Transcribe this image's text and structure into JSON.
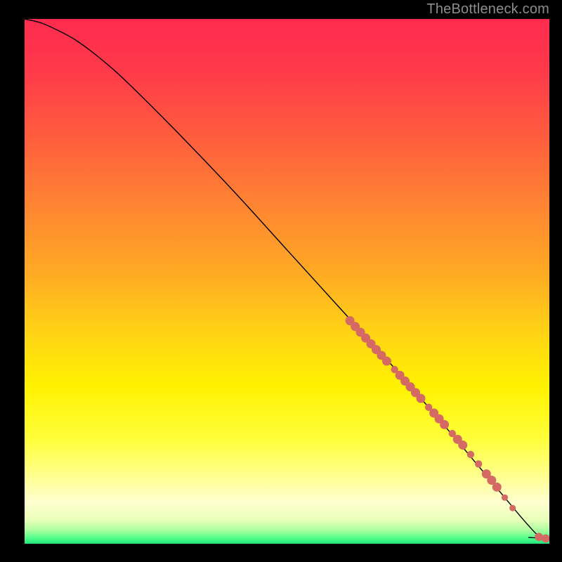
{
  "attribution": "TheBottleneck.com",
  "colors": {
    "background": "#000000",
    "curve": "#000000",
    "scatter": "#d46a63",
    "attribution_text": "#8d8d8d"
  },
  "gradient_stops": [
    {
      "offset": 0.0,
      "color": "#ff2b4f"
    },
    {
      "offset": 0.1,
      "color": "#ff3a4a"
    },
    {
      "offset": 0.22,
      "color": "#ff5c3e"
    },
    {
      "offset": 0.35,
      "color": "#ff8332"
    },
    {
      "offset": 0.48,
      "color": "#ffa924"
    },
    {
      "offset": 0.6,
      "color": "#ffd414"
    },
    {
      "offset": 0.7,
      "color": "#fff200"
    },
    {
      "offset": 0.8,
      "color": "#ffff3a"
    },
    {
      "offset": 0.87,
      "color": "#ffff8e"
    },
    {
      "offset": 0.92,
      "color": "#ffffd0"
    },
    {
      "offset": 0.955,
      "color": "#e8ffb8"
    },
    {
      "offset": 0.975,
      "color": "#a8ff9e"
    },
    {
      "offset": 0.99,
      "color": "#4cff8a"
    },
    {
      "offset": 1.0,
      "color": "#22e37a"
    }
  ],
  "chart_data": {
    "type": "line",
    "title": "",
    "xlabel": "",
    "ylabel": "",
    "xlim": [
      0,
      100
    ],
    "ylim": [
      0,
      100
    ],
    "series": [
      {
        "name": "curve",
        "x": [
          0,
          3,
          6,
          10,
          15,
          20,
          30,
          40,
          50,
          60,
          70,
          80,
          88,
          93,
          96,
          98,
          100
        ],
        "y": [
          100,
          99.3,
          98.0,
          95.8,
          92.0,
          87.5,
          77.5,
          67.0,
          56.0,
          45.0,
          34.0,
          22.5,
          13.0,
          7.0,
          3.5,
          1.5,
          1.0
        ]
      }
    ],
    "scatter": {
      "name": "highlight-points",
      "points": [
        {
          "x": 62,
          "y": 42.5,
          "r": 1.0
        },
        {
          "x": 63,
          "y": 41.4,
          "r": 1.0
        },
        {
          "x": 64,
          "y": 40.3,
          "r": 1.0
        },
        {
          "x": 65,
          "y": 39.2,
          "r": 1.0
        },
        {
          "x": 66,
          "y": 38.1,
          "r": 1.0
        },
        {
          "x": 67,
          "y": 37.0,
          "r": 1.0
        },
        {
          "x": 68,
          "y": 35.9,
          "r": 1.0
        },
        {
          "x": 69,
          "y": 34.8,
          "r": 1.0
        },
        {
          "x": 70.5,
          "y": 33.2,
          "r": 0.8
        },
        {
          "x": 71.5,
          "y": 32.1,
          "r": 1.0
        },
        {
          "x": 72.5,
          "y": 31.0,
          "r": 1.0
        },
        {
          "x": 73.5,
          "y": 29.9,
          "r": 1.0
        },
        {
          "x": 74.5,
          "y": 28.8,
          "r": 1.0
        },
        {
          "x": 75.5,
          "y": 27.7,
          "r": 1.0
        },
        {
          "x": 77.0,
          "y": 26.0,
          "r": 0.8
        },
        {
          "x": 78.0,
          "y": 24.9,
          "r": 1.0
        },
        {
          "x": 79.0,
          "y": 23.8,
          "r": 1.0
        },
        {
          "x": 80.0,
          "y": 22.7,
          "r": 1.0
        },
        {
          "x": 81.5,
          "y": 21.0,
          "r": 0.8
        },
        {
          "x": 82.5,
          "y": 19.9,
          "r": 1.0
        },
        {
          "x": 83.5,
          "y": 18.8,
          "r": 1.0
        },
        {
          "x": 85.0,
          "y": 17.0,
          "r": 0.8
        },
        {
          "x": 86.5,
          "y": 15.2,
          "r": 0.8
        },
        {
          "x": 88.0,
          "y": 13.3,
          "r": 1.0
        },
        {
          "x": 89.0,
          "y": 12.1,
          "r": 1.0
        },
        {
          "x": 90.0,
          "y": 10.8,
          "r": 1.0
        },
        {
          "x": 91.5,
          "y": 8.8,
          "r": 0.7
        },
        {
          "x": 93.0,
          "y": 6.8,
          "r": 0.7
        },
        {
          "x": 98.0,
          "y": 1.3,
          "r": 0.9
        },
        {
          "x": 99.3,
          "y": 1.0,
          "r": 0.9
        }
      ]
    }
  }
}
